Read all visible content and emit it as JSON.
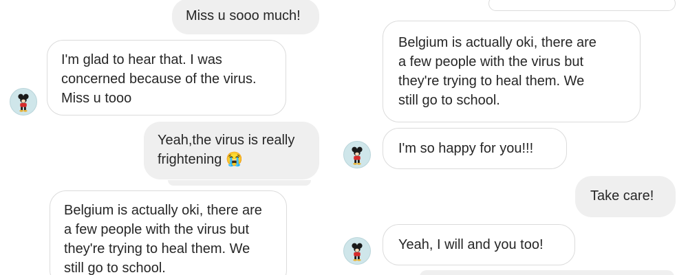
{
  "left": {
    "messages": [
      {
        "from": "me",
        "text": "Miss u sooo much!"
      },
      {
        "from": "contact",
        "text": "I'm glad to hear that. I was\nconcerned because of the virus.\nMiss u tooo"
      },
      {
        "from": "me",
        "text": "Yeah,the virus is really\nfrightening 😭"
      },
      {
        "from": "contact",
        "text": "Belgium is actually oki, there are\na few people with the virus but\nthey're trying to heal them. We\nstill go to school."
      }
    ]
  },
  "right": {
    "messages": [
      {
        "from": "contact",
        "text": "Belgium is actually oki, there are\na few people with the virus but\nthey're trying to heal them. We\nstill go to school."
      },
      {
        "from": "contact",
        "text": "I'm so happy for you!!!"
      },
      {
        "from": "me",
        "text": "Take care!"
      },
      {
        "from": "contact",
        "text": "Yeah, I will and you too!"
      }
    ]
  },
  "contact": {
    "avatar_icon": "mickey-mouse-avatar-icon"
  },
  "colors": {
    "sent_bg": "#efefef",
    "recv_border": "#dbdbdb",
    "text": "#262626",
    "avatar_bg": "#cfe6ea"
  }
}
